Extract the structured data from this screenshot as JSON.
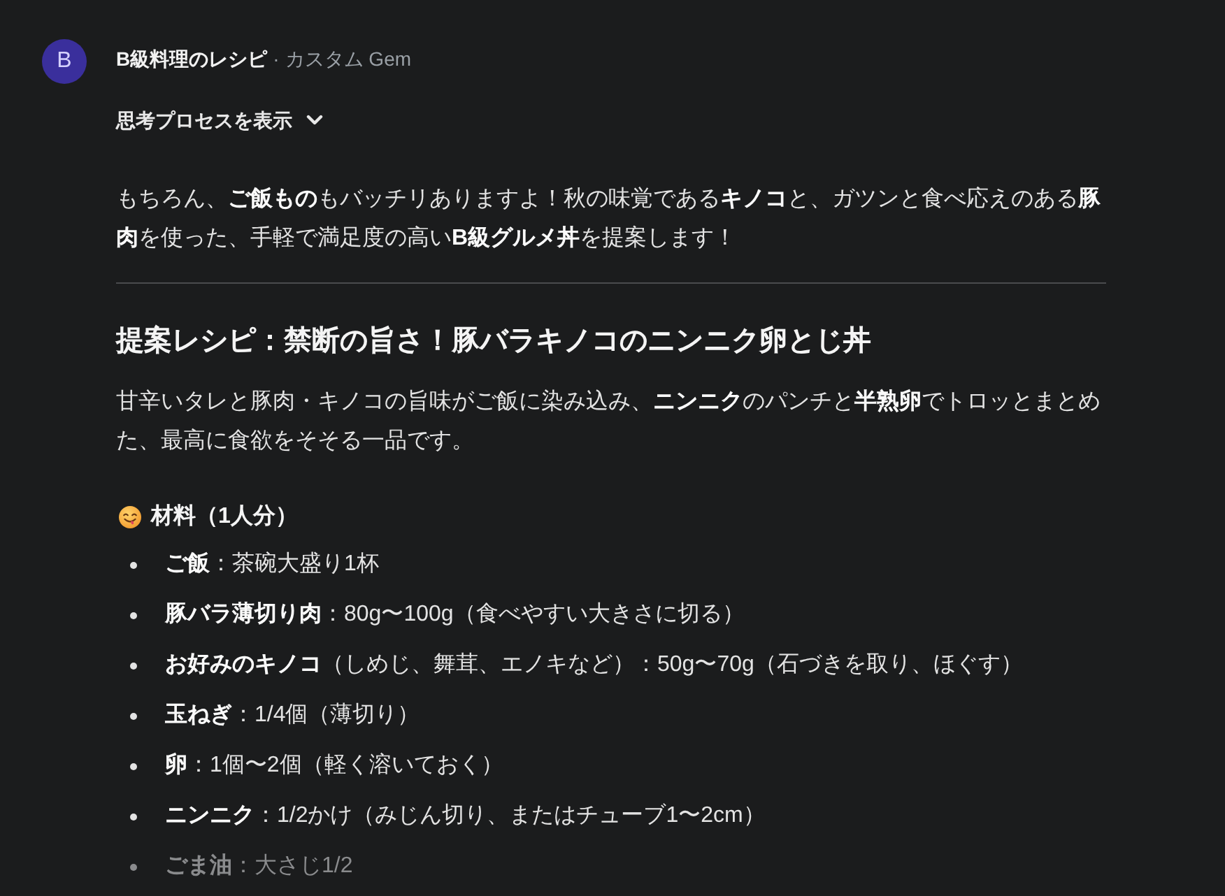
{
  "gem": {
    "avatar_letter": "B",
    "name": "B級料理のレシピ",
    "separator": "·",
    "type": "カスタム Gem"
  },
  "thinking_toggle": {
    "label": "思考プロセスを表示",
    "expanded": false
  },
  "intro": "もちろん、**ご飯もの**もバッチリありますよ！秋の味覚である**キノコ**と、ガツンと食べ応えのある**豚肉**を使った、手軽で満足度の高い**B級グルメ丼**を提案します！",
  "recipe": {
    "title": "提案レシピ：禁断の旨さ！豚バラキノコのニンニク卵とじ丼",
    "description": "甘辛いタレと豚肉・キノコの旨味がご飯に染み込み、**ニンニク**のパンチと**半熟卵**でトロッとまとめた、最高に食欲をそそる一品です。",
    "ingredients": {
      "heading": "材料（1人分）",
      "items": [
        {
          "text": "**ご飯**：茶碗大盛り1杯",
          "faded": false
        },
        {
          "text": "**豚バラ薄切り肉**：80g〜100g（食べやすい大きさに切る）",
          "faded": false
        },
        {
          "text": "**お好みのキノコ**（しめじ、舞茸、エノキなど）：50g〜70g（石づきを取り、ほぐす）",
          "faded": false
        },
        {
          "text": "**玉ねぎ**：1/4個（薄切り）",
          "faded": false
        },
        {
          "text": "**卵**：1個〜2個（軽く溶いておく）",
          "faded": false
        },
        {
          "text": "**ニンニク**：1/2かけ（みじん切り、またはチューブ1〜2cm）",
          "faded": false
        },
        {
          "text": "**ごま油**：大さじ1/2",
          "faded": true
        }
      ]
    }
  }
}
